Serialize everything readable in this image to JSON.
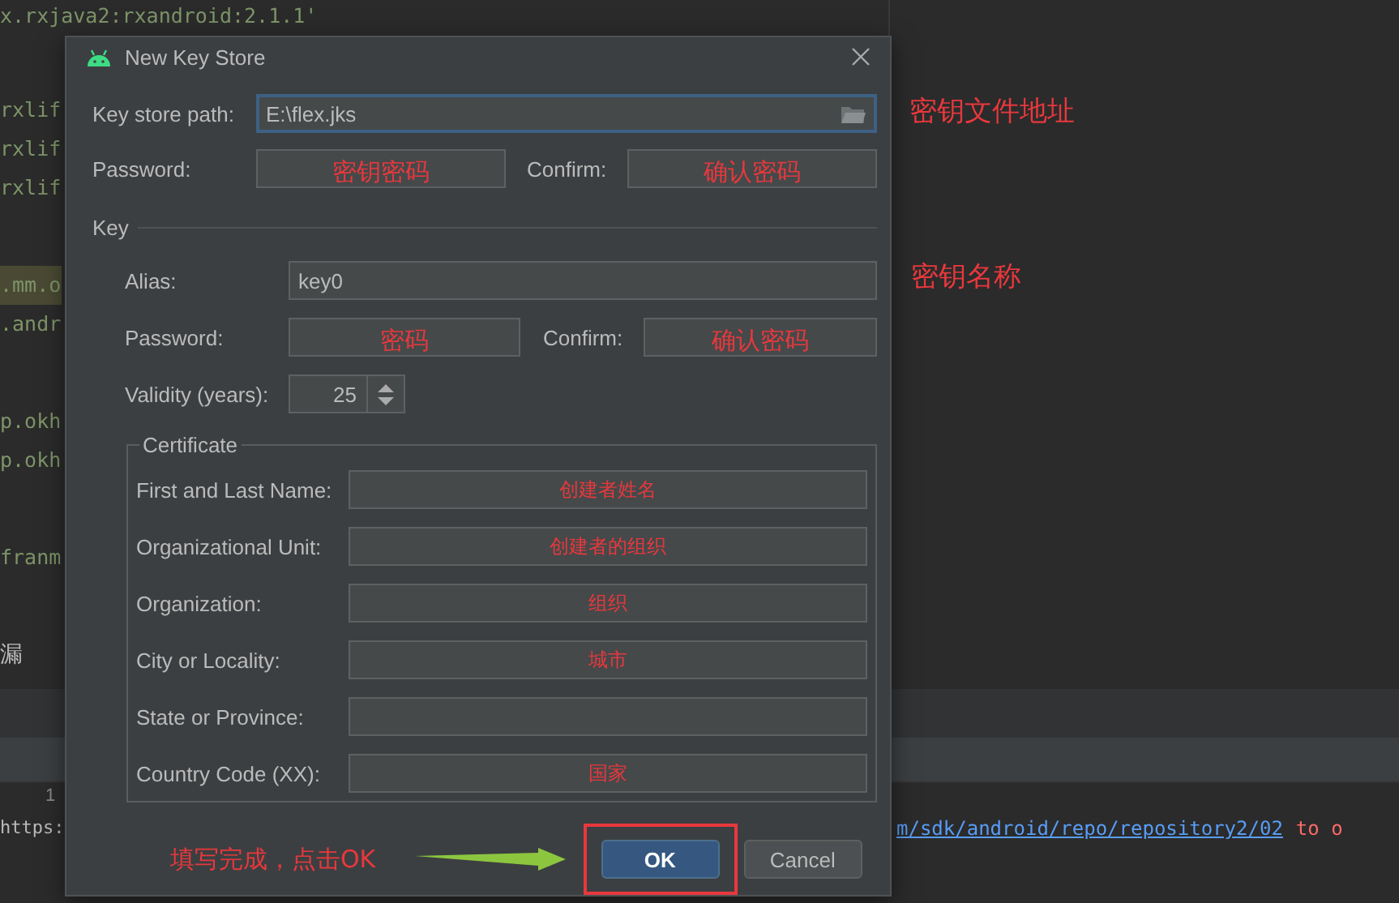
{
  "editor": {
    "code_blocks": [
      [
        {
          "text": "x.rxjava2:rxandroid:2.1.1'",
          "highlighted": false
        }
      ],
      [
        {
          "text": "rxlif",
          "highlighted": false
        },
        {
          "text": "rxlif",
          "highlighted": false
        },
        {
          "text": "rxlif",
          "highlighted": false
        }
      ],
      [
        {
          "text": ".mm.o",
          "highlighted": true
        },
        {
          "text": ".andr",
          "highlighted": false
        }
      ],
      [
        {
          "text": "p.okh",
          "highlighted": false
        },
        {
          "text": "p.okh",
          "highlighted": false
        }
      ],
      [
        {
          "text": "franm",
          "highlighted": false
        }
      ],
      [
        {
          "text": "漏",
          "highlighted": false
        }
      ]
    ]
  },
  "console": {
    "timestamp": "1",
    "url_start": "https:",
    "link": "m/sdk/android/repo/repository2/02",
    "message": "to o"
  },
  "dialog": {
    "title": "New Key Store",
    "keystore_rows": [
      [
        {
          "label": "Key store path:",
          "value": "E:\\flex.jks",
          "kind": "path",
          "focused": true,
          "note": "密钥文件地址"
        }
      ],
      [
        {
          "label": "Password:",
          "kind": "text",
          "focused": false,
          "annotation": "密钥密码"
        },
        {
          "label": "Confirm:",
          "kind": "text",
          "focused": false,
          "annotation": "确认密码"
        }
      ]
    ],
    "key_section": {
      "title": "Key",
      "rows": [
        [
          {
            "label": "Alias:",
            "value": "key0",
            "kind": "text",
            "focused": false,
            "note": "密钥名称"
          }
        ],
        [
          {
            "label": "Password:",
            "kind": "text",
            "focused": false,
            "annotation": "密码"
          },
          {
            "label": "Confirm:",
            "kind": "text",
            "focused": false,
            "annotation": "确认密码"
          }
        ],
        [
          {
            "label": "Validity (years):",
            "value": "25",
            "kind": "spinner",
            "focused": false
          }
        ]
      ],
      "certificate": {
        "title": "Certificate",
        "fields": [
          {
            "label": "First and Last Name:",
            "kind": "text",
            "focused": false,
            "annotation": "创建者姓名"
          },
          {
            "label": "Organizational Unit:",
            "kind": "text",
            "focused": false,
            "annotation": "创建者的组织"
          },
          {
            "label": "Organization:",
            "kind": "text",
            "focused": false,
            "annotation": "组织"
          },
          {
            "label": "City or Locality:",
            "kind": "text",
            "focused": false,
            "annotation": "城市"
          },
          {
            "label": "State or Province:",
            "kind": "text",
            "focused": false
          },
          {
            "label": "Country Code (XX):",
            "kind": "text",
            "focused": false,
            "annotation": "国家"
          }
        ]
      }
    },
    "instruction": "填写完成，点击OK",
    "buttons": [
      {
        "label": "OK",
        "default": true,
        "highlighted": true
      },
      {
        "label": "Cancel",
        "default": false,
        "highlighted": false
      }
    ]
  }
}
